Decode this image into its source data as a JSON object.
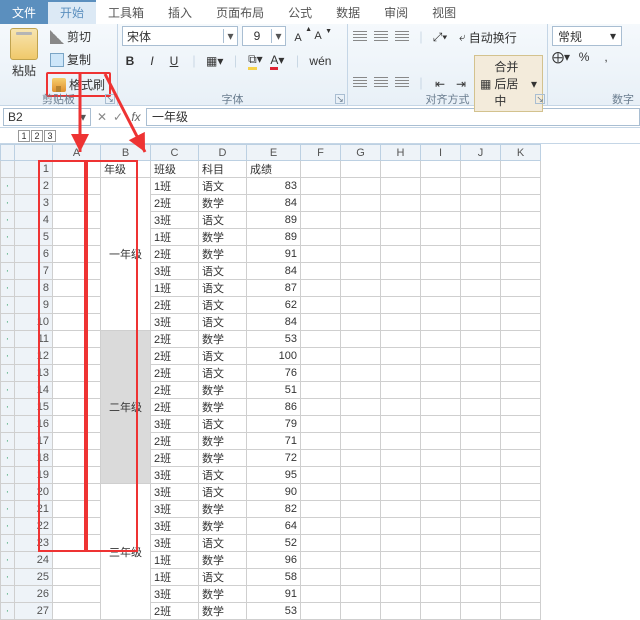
{
  "menu": {
    "file": "文件",
    "home": "开始",
    "toolbox": "工具箱",
    "insert": "插入",
    "pagelayout": "页面布局",
    "formula": "公式",
    "data": "数据",
    "review": "审阅",
    "view": "视图"
  },
  "ribbon": {
    "clipboard": {
      "paste": "粘贴",
      "cut": "剪切",
      "copy": "复制",
      "format_painter": "格式刷",
      "group": "剪贴板"
    },
    "font": {
      "name": "宋体",
      "size": "9",
      "group": "字体",
      "bold": "B",
      "italic": "I",
      "underline": "U",
      "wen": "wén"
    },
    "align": {
      "group": "对齐方式",
      "wrap": "自动换行",
      "merge": "合并后居中"
    },
    "number": {
      "group": "数字",
      "format": "常规"
    }
  },
  "formula_bar": {
    "cellref": "B2",
    "value": "一年级"
  },
  "outline_levels": [
    "1",
    "2",
    "3"
  ],
  "columns": [
    "A",
    "B",
    "C",
    "D",
    "E",
    "F",
    "G",
    "H",
    "I",
    "J",
    "K"
  ],
  "headers": {
    "b": "年级",
    "c": "班级",
    "d": "科目",
    "e": "成绩"
  },
  "grade_labels": {
    "g1": "一年级",
    "g2": "二年级",
    "g3": "三年级"
  },
  "rows": [
    {
      "c": "1班",
      "d": "语文",
      "e": 83
    },
    {
      "c": "2班",
      "d": "数学",
      "e": 84
    },
    {
      "c": "3班",
      "d": "语文",
      "e": 89
    },
    {
      "c": "1班",
      "d": "数学",
      "e": 89
    },
    {
      "c": "2班",
      "d": "数学",
      "e": 91
    },
    {
      "c": "3班",
      "d": "语文",
      "e": 84
    },
    {
      "c": "1班",
      "d": "语文",
      "e": 87
    },
    {
      "c": "2班",
      "d": "语文",
      "e": 62
    },
    {
      "c": "3班",
      "d": "语文",
      "e": 84
    },
    {
      "c": "2班",
      "d": "数学",
      "e": 53
    },
    {
      "c": "2班",
      "d": "语文",
      "e": 100
    },
    {
      "c": "2班",
      "d": "语文",
      "e": 76
    },
    {
      "c": "2班",
      "d": "数学",
      "e": 51
    },
    {
      "c": "2班",
      "d": "数学",
      "e": 86
    },
    {
      "c": "3班",
      "d": "语文",
      "e": 79
    },
    {
      "c": "2班",
      "d": "数学",
      "e": 71
    },
    {
      "c": "2班",
      "d": "数学",
      "e": 72
    },
    {
      "c": "3班",
      "d": "语文",
      "e": 95
    },
    {
      "c": "3班",
      "d": "语文",
      "e": 90
    },
    {
      "c": "3班",
      "d": "数学",
      "e": 82
    },
    {
      "c": "3班",
      "d": "数学",
      "e": 64
    },
    {
      "c": "3班",
      "d": "语文",
      "e": 52
    },
    {
      "c": "1班",
      "d": "数学",
      "e": 96
    },
    {
      "c": "1班",
      "d": "语文",
      "e": 58
    },
    {
      "c": "3班",
      "d": "数学",
      "e": 91
    },
    {
      "c": "2班",
      "d": "数学",
      "e": 53
    }
  ]
}
